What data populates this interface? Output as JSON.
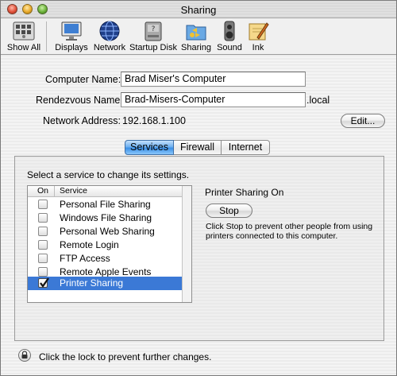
{
  "window": {
    "title": "Sharing"
  },
  "toolbar": {
    "items": [
      {
        "label": "Show All",
        "icon": "show-all-icon"
      },
      {
        "label": "Displays",
        "icon": "display-icon"
      },
      {
        "label": "Network",
        "icon": "network-globe-icon"
      },
      {
        "label": "Startup Disk",
        "icon": "startup-disk-icon"
      },
      {
        "label": "Sharing",
        "icon": "sharing-folder-icon"
      },
      {
        "label": "Sound",
        "icon": "speaker-icon"
      },
      {
        "label": "Ink",
        "icon": "ink-pen-icon"
      }
    ]
  },
  "form": {
    "computer_name_label": "Computer Name:",
    "computer_name_value": "Brad Miser's Computer",
    "rendezvous_label": "Rendezvous Name:",
    "rendezvous_value": "Brad-Misers-Computer",
    "rendezvous_suffix": ".local",
    "network_address_label": "Network Address:",
    "network_address_value": "192.168.1.100",
    "edit_button": "Edit..."
  },
  "tabs": [
    {
      "label": "Services",
      "active": true
    },
    {
      "label": "Firewall",
      "active": false
    },
    {
      "label": "Internet",
      "active": false
    }
  ],
  "services": {
    "instruction": "Select a service to change its settings.",
    "col_on": "On",
    "col_service": "Service",
    "items": [
      {
        "name": "Personal File Sharing",
        "on": false,
        "selected": false
      },
      {
        "name": "Windows File Sharing",
        "on": false,
        "selected": false
      },
      {
        "name": "Personal Web Sharing",
        "on": false,
        "selected": false
      },
      {
        "name": "Remote Login",
        "on": false,
        "selected": false
      },
      {
        "name": "FTP Access",
        "on": false,
        "selected": false
      },
      {
        "name": "Remote Apple Events",
        "on": false,
        "selected": false
      },
      {
        "name": "Printer Sharing",
        "on": true,
        "selected": true
      }
    ]
  },
  "detail": {
    "status": "Printer Sharing On",
    "button": "Stop",
    "description": "Click Stop to prevent other people from using printers connected to this computer."
  },
  "footer": {
    "lock_text": "Click the lock to prevent further changes.",
    "icon": "lock-icon"
  },
  "colors": {
    "selection": "#3b79d6",
    "tab_active": "#3b8fe6"
  }
}
